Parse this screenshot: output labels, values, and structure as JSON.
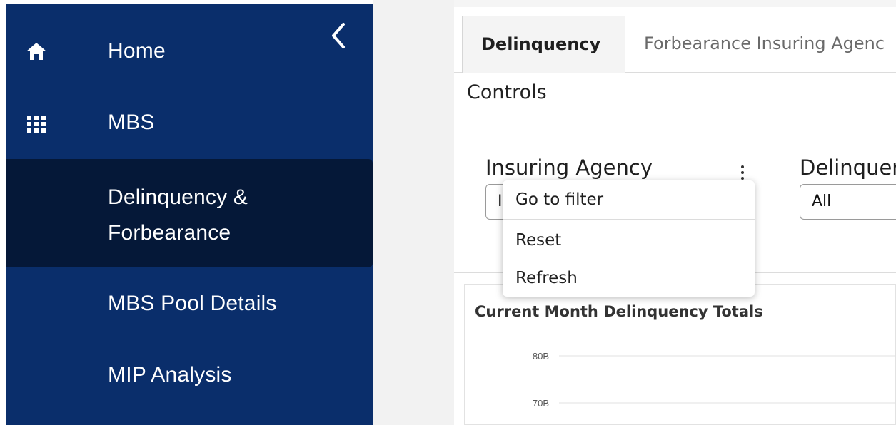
{
  "sidebar": {
    "items": [
      {
        "label": "Home",
        "icon": "home-icon"
      },
      {
        "label": "MBS",
        "icon": "grid-icon"
      },
      {
        "label_line1": "Delinquency &",
        "label_line2": "Forbearance",
        "active": true
      },
      {
        "label": "MBS Pool Details"
      },
      {
        "label": "MIP Analysis"
      }
    ],
    "collapse_icon": "chevron-left-icon"
  },
  "tabs": [
    {
      "label": "Delinquency",
      "active": true
    },
    {
      "label": "Forbearance Insuring Agenc"
    }
  ],
  "controls": {
    "title": "Controls",
    "filters": [
      {
        "label": "Insuring Agency",
        "value": "I"
      },
      {
        "label": "Delinquer",
        "value": "All"
      }
    ]
  },
  "context_menu": {
    "items": [
      "Go to filter",
      "Reset",
      "Refresh"
    ]
  },
  "chart_data": {
    "type": "bar",
    "title": "Current Month Delinquency Totals",
    "y_ticks": [
      "80B",
      "70B"
    ],
    "categories": [],
    "values": []
  },
  "colors": {
    "sidebar_bg": "#0a2e6b",
    "sidebar_active_bg": "#051838"
  }
}
